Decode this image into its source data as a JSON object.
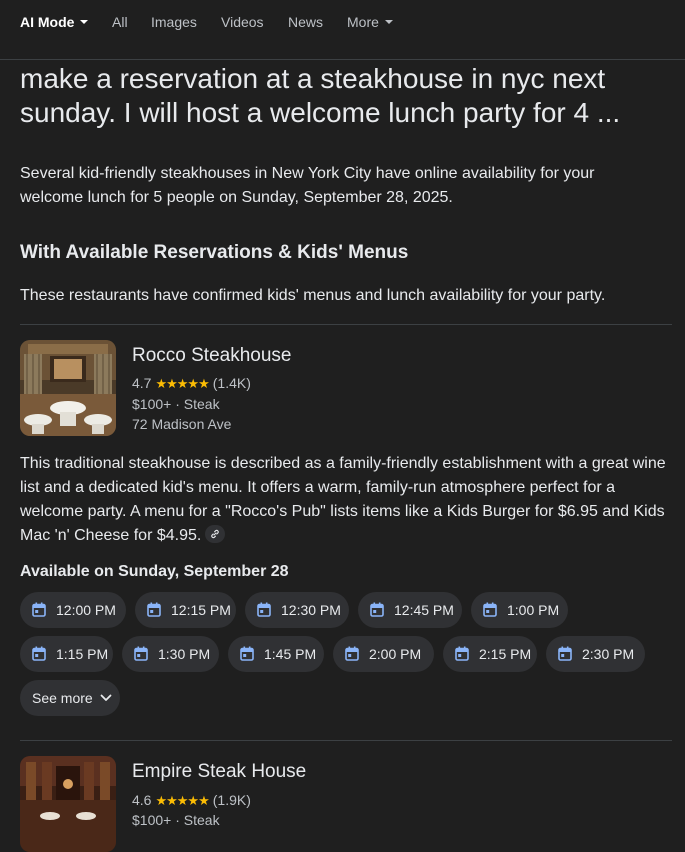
{
  "nav": {
    "items": [
      {
        "label": "AI Mode",
        "active": true,
        "dropdown": true
      },
      {
        "label": "All"
      },
      {
        "label": "Images"
      },
      {
        "label": "Videos"
      },
      {
        "label": "News"
      },
      {
        "label": "More",
        "dropdown": true
      }
    ]
  },
  "query": "make a reservation at a steakhouse in nyc next sunday. I will host a welcome lunch party for 4 ...",
  "intro": "Several kid-friendly steakhouses in New York City have online availability for your welcome lunch for 5 people on Sunday, September 28, 2025.",
  "section": {
    "heading": "With Available Reservations & Kids' Menus",
    "description": "These restaurants have confirmed kids' menus and lunch availability for your party."
  },
  "restaurants": [
    {
      "name": "Rocco Steakhouse",
      "rating": "4.7",
      "stars": "★★★★★",
      "reviews": "(1.4K)",
      "price": "$100+",
      "cuisine": "Steak",
      "address": "72 Madison Ave",
      "description": "This traditional steakhouse is described as a family-friendly establishment with a great wine list and a dedicated kid's menu. It offers a warm, family-run atmosphere perfect for a welcome party. A menu for a \"Rocco's Pub\" lists items like a Kids Burger for $6.95 and Kids Mac 'n' Cheese for $4.95.",
      "availability_label": "Available on Sunday, September 28",
      "times": [
        "12:00 PM",
        "12:15 PM",
        "12:30 PM",
        "12:45 PM",
        "1:00 PM",
        "1:15 PM",
        "1:30 PM",
        "1:45 PM",
        "2:00 PM",
        "2:15 PM",
        "2:30 PM"
      ],
      "see_more": "See more"
    },
    {
      "name": "Empire Steak House",
      "rating": "4.6",
      "stars": "★★★★★",
      "reviews": "(1.9K)",
      "price": "$100+",
      "cuisine": "Steak"
    }
  ],
  "colors": {
    "background": "#1f1f1f",
    "chip": "#303134",
    "calendar_icon": "#8ab4f8",
    "stars": "#fbbc04"
  },
  "icons": {
    "slot": "calendar-icon",
    "link": "link-icon",
    "see_more": "chevron-down-icon"
  }
}
